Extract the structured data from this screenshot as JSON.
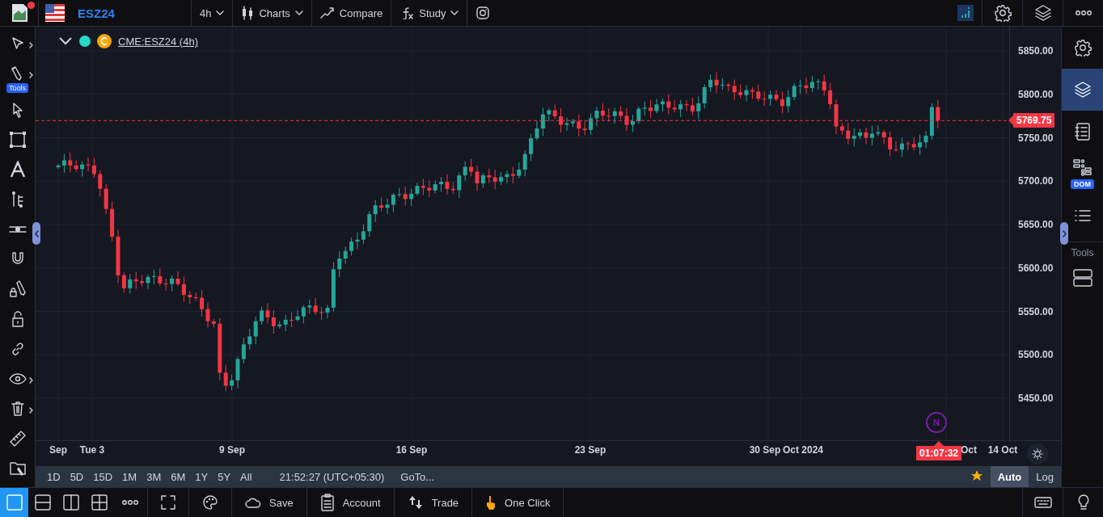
{
  "top_bar": {
    "symbol": "ESZ24",
    "menus": [
      {
        "kind": "interval",
        "label": "4h"
      },
      {
        "kind": "charts",
        "label": "Charts"
      },
      {
        "kind": "compare",
        "label": "Compare"
      },
      {
        "kind": "study",
        "label": "Study"
      },
      {
        "kind": "instagram"
      }
    ],
    "actions": [
      {
        "kind": "mini_chart"
      },
      {
        "kind": "settings"
      },
      {
        "kind": "layers"
      },
      {
        "kind": "more"
      }
    ]
  },
  "left_toolbar": {
    "items": [
      {
        "kind": "cursor",
        "has_submenu": true
      },
      {
        "kind": "pencil",
        "has_submenu": true,
        "badge": "Tools"
      },
      {
        "kind": "arrow",
        "has_submenu": false
      },
      {
        "kind": "rectangle",
        "has_submenu": false
      },
      {
        "kind": "text",
        "has_submenu": false
      },
      {
        "kind": "fib",
        "has_submenu": false
      },
      {
        "kind": "hline",
        "has_submenu": false
      },
      {
        "kind": "magnet",
        "has_submenu": false
      },
      {
        "kind": "lock_draw",
        "has_submenu": false
      },
      {
        "kind": "lock",
        "has_submenu": false
      },
      {
        "kind": "link",
        "has_submenu": false
      },
      {
        "kind": "eye",
        "has_submenu": true
      },
      {
        "kind": "trash",
        "has_submenu": true
      },
      {
        "kind": "ruler",
        "has_submenu": false
      },
      {
        "kind": "folder",
        "has_submenu": false
      }
    ]
  },
  "legend": {
    "symbol": "CME:ESZ24 (4h)"
  },
  "price_axis": {
    "ticks": [
      "5850.00",
      "5800.00",
      "5750.00",
      "5700.00",
      "5650.00",
      "5600.00",
      "5550.00",
      "5500.00",
      "5450.00"
    ],
    "last_price": "5769.75"
  },
  "event_marker": "N",
  "time_axis": {
    "labels": [
      "Sep",
      "Tue 3",
      "9 Sep",
      "16 Sep",
      "23 Sep",
      "30 Sep",
      "Oct 2024",
      "Oct",
      "14 Oct"
    ],
    "countdown": "01:07:32"
  },
  "range_bar": {
    "ranges": [
      "1D",
      "5D",
      "15D",
      "1M",
      "3M",
      "6M",
      "1Y",
      "5Y",
      "All"
    ],
    "time": "21:52:27 (UTC+05:30)",
    "goto": "GoTo...",
    "scale_modes": [
      {
        "label": "Auto",
        "selected": true
      },
      {
        "label": "Log",
        "selected": false
      }
    ]
  },
  "bottom_bar": {
    "layouts": [
      {
        "kind": "single",
        "selected": true
      },
      {
        "kind": "rows",
        "selected": false
      },
      {
        "kind": "columns",
        "selected": false
      },
      {
        "kind": "grid",
        "selected": false
      }
    ],
    "buttons": [
      {
        "kind": "more"
      },
      {
        "kind": "fullscreen"
      },
      {
        "kind": "palette"
      },
      {
        "kind": "save",
        "label": "Save"
      },
      {
        "kind": "account",
        "label": "Account"
      },
      {
        "kind": "trade",
        "label": "Trade"
      },
      {
        "kind": "one_click",
        "label": "One Click"
      }
    ],
    "right_actions": [
      {
        "kind": "keyboard"
      },
      {
        "kind": "bulb"
      }
    ]
  },
  "right_sidebar": {
    "items": [
      {
        "kind": "settings",
        "selected": false
      },
      {
        "kind": "layers",
        "selected": true
      },
      {
        "kind": "notes",
        "selected": false
      },
      {
        "kind": "dom",
        "selected": false,
        "badge": "DOM"
      },
      {
        "kind": "list",
        "selected": false
      }
    ],
    "section_label": "Tools",
    "tools": [
      {
        "kind": "server"
      }
    ]
  }
}
